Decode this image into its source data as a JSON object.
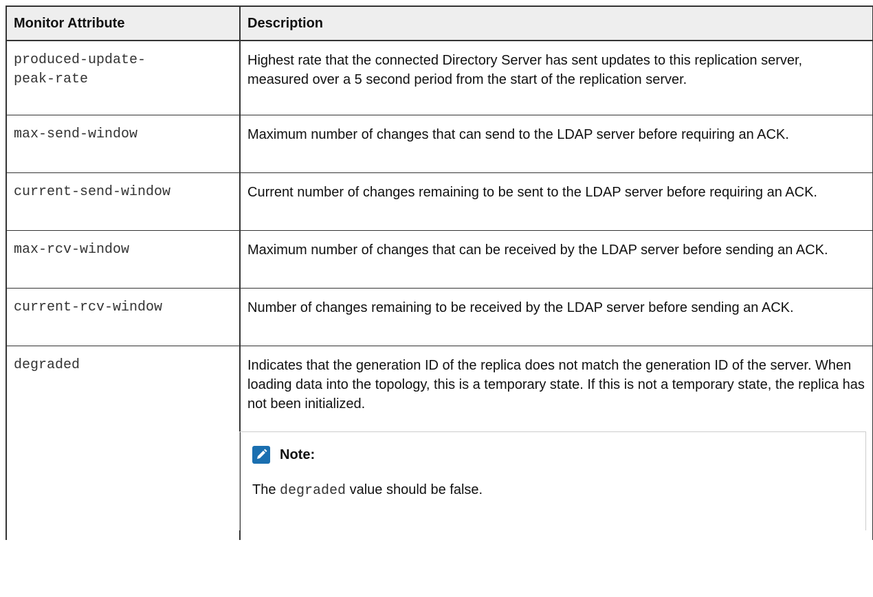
{
  "table": {
    "headers": [
      "Monitor Attribute",
      "Description"
    ],
    "rows": [
      {
        "attribute": "produced-update-\npeak-rate",
        "description": "Highest rate that the connected Directory Server has sent updates to this replication server, measured over a 5 second period from the start of the replication server."
      },
      {
        "attribute": "max-send-window",
        "description": "Maximum number of changes that can send to the LDAP server before requiring an ACK."
      },
      {
        "attribute": "current-send-window",
        "description": "Current number of changes remaining to be sent to the LDAP server before requiring an ACK."
      },
      {
        "attribute": "max-rcv-window",
        "description": "Maximum number of changes that can be received by the LDAP server before sending an ACK."
      },
      {
        "attribute": "current-rcv-window",
        "description": "Number of changes remaining to be received by the LDAP server before sending an ACK."
      },
      {
        "attribute": "degraded",
        "description": "Indicates that the generation ID of the replica does not match the generation ID of the server. When loading data into the topology, this is a temporary state. If this is not a temporary state, the replica has not been initialized."
      }
    ]
  },
  "note": {
    "icon": "note-pencil-icon",
    "title": "Note:",
    "text_before": "The ",
    "code": "degraded",
    "text_after": " value should be false."
  },
  "colors": {
    "header_bg": "#eeeeee",
    "border": "#333333",
    "note_icon": "#1a6fb0"
  }
}
